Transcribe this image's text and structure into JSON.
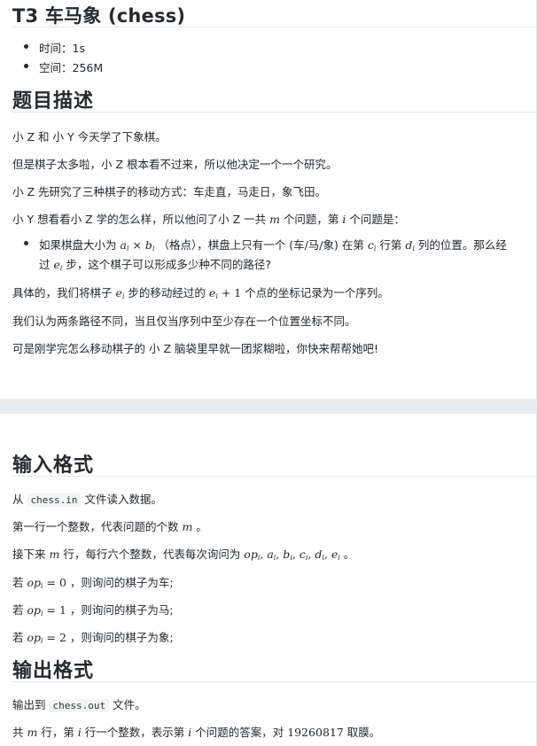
{
  "title": "T3 车马象 (chess)",
  "limits": {
    "time_label": "时间：",
    "time_value": "1s",
    "space_label": "空间：",
    "space_value": "256M"
  },
  "description": {
    "heading": "题目描述",
    "p1": "小 Z 和 小 Y 今天学了下象棋。",
    "p2": "但是棋子太多啦，小 Z 根本看不过来，所以他决定一个一个研究。",
    "p3": "小 Z 先研究了三种棋子的移动方式：车走直，马走日，象飞田。",
    "p4_a": "小 Y 想看看小 Z 学的怎么样，所以他问了小 Z 一共 ",
    "p4_m": "m",
    "p4_b": " 个问题，第 ",
    "p4_i": "i",
    "p4_c": " 个问题是：",
    "li_a": "如果棋盘大小为 ",
    "li_ab": "a",
    "li_times": " × ",
    "li_bb": "b",
    "li_sub_i": "i",
    "li_b": " （格点），棋盘上只有一个 (车/马/象) 在第 ",
    "li_c": "c",
    "li_c2": " 行第 ",
    "li_d": "d",
    "li_d2": " 列的位置。那么经",
    "li2_a": "过 ",
    "li2_e": "e",
    "li2_b": " 步，这个棋子可以形成多少种不同的路径?",
    "p5_a": "具体的，我们将棋子 ",
    "p5_e": "e",
    "p5_b": " 步的移动经过的 ",
    "p5_plus": " + 1",
    "p5_c": " 个点的坐标记录为一个序列。",
    "p6": "我们认为两条路径不同，当且仅当序列中至少存在一个位置坐标不同。",
    "p7": "可是刚学完怎么移动棋子的 小 Z 脑袋里早就一团浆糊啦，你快来帮帮她吧!"
  },
  "input": {
    "heading": "输入格式",
    "p1_a": "从 ",
    "p1_code": "chess.in",
    "p1_b": " 文件读入数据。",
    "p2_a": "第一行一个整数，代表问题的个数 ",
    "p2_m": "m",
    "p2_b": " 。",
    "p3_a": "接下来 ",
    "p3_m": "m",
    "p3_b": " 行，每行六个整数，代表每次询问为 ",
    "p3_vars": "op",
    "p3_list": ", a",
    "p3_list2": ", b",
    "p3_list3": ", c",
    "p3_list4": ", d",
    "p3_list5": ", e",
    "p3_c": " 。",
    "case1_a": "若 ",
    "case1_op": "op",
    "case1_eq": " = 0",
    "case1_b": " ，则询问的棋子为车;",
    "case2_eq": " = 1",
    "case2_b": " ，则询问的棋子为马;",
    "case3_eq": " = 2",
    "case3_b": " ，则询问的棋子为象;"
  },
  "output": {
    "heading": "输出格式",
    "p1_a": "输出到 ",
    "p1_code": "chess.out",
    "p1_b": " 文件。",
    "p2_a": "共 ",
    "p2_m": "m",
    "p2_b": " 行，第 ",
    "p2_i": "i",
    "p2_c": " 行一个整数，表示第 ",
    "p2_i2": "i",
    "p2_d": " 个问题的答案，对 ",
    "p2_mod": "19260817",
    "p2_e": " 取膜。"
  }
}
